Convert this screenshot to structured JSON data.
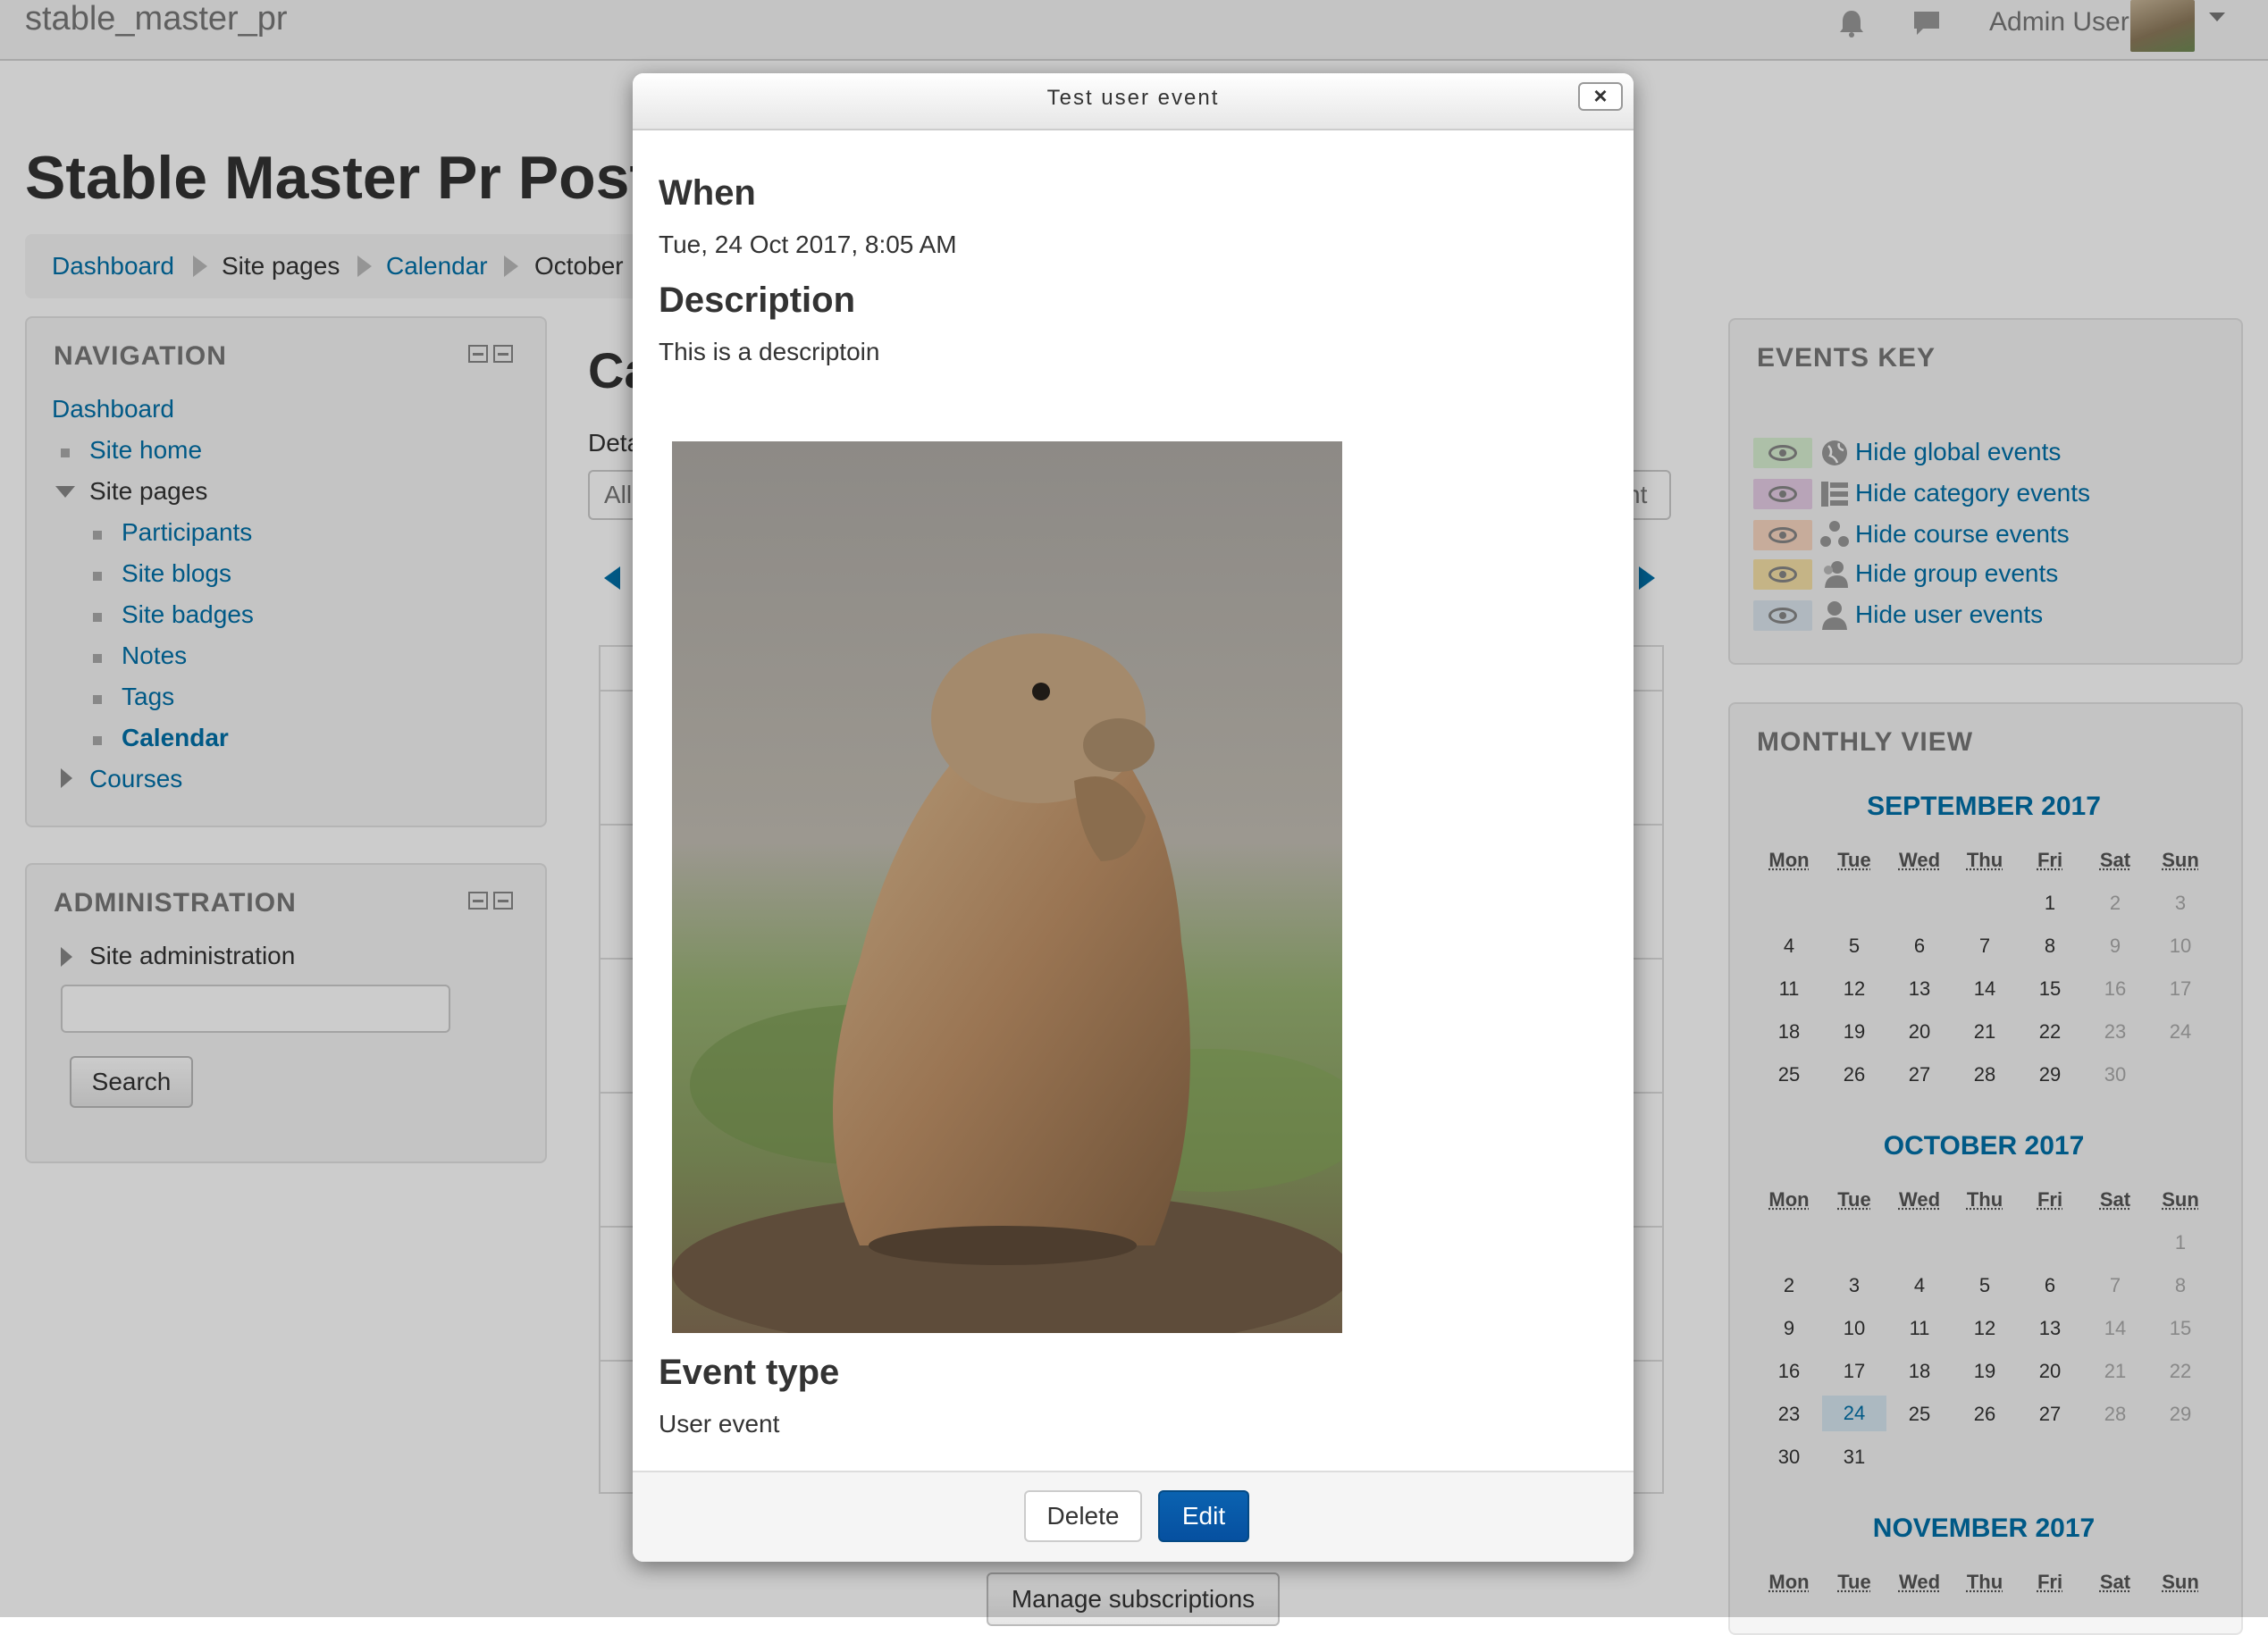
{
  "navbar": {
    "brand": "stable_master_pr",
    "user_name": "Admin User",
    "icons": [
      "notification-bell-icon",
      "messages-icon",
      "user-menu-caret-icon"
    ]
  },
  "page": {
    "title": "Stable Master Pr Postg",
    "breadcrumb": [
      "Dashboard",
      "Site pages",
      "Calendar",
      "October"
    ]
  },
  "navigation": {
    "title": "NAVIGATION",
    "dashboard": "Dashboard",
    "site_home": "Site home",
    "site_pages": "Site pages",
    "items": [
      "Participants",
      "Site blogs",
      "Site badges",
      "Notes",
      "Tags",
      "Calendar"
    ],
    "courses": "Courses"
  },
  "administration": {
    "title": "ADMINISTRATION",
    "site_admin": "Site administration",
    "search_value": "",
    "search_button": "Search"
  },
  "center": {
    "heading_fragment": "Ca",
    "details_fragment": "Deta",
    "filter_fragment_left": "All",
    "filter_fragment_right": "nt",
    "manage_button": "Manage subscriptions"
  },
  "events_key": {
    "title": "EVENTS KEY",
    "items": [
      {
        "label": "Hide global events",
        "color": "#d9f0d3",
        "icon": "globe-icon"
      },
      {
        "label": "Hide category events",
        "color": "#e6cde6",
        "icon": "category-icon"
      },
      {
        "label": "Hide course events",
        "color": "#f9d7c2",
        "icon": "course-icon"
      },
      {
        "label": "Hide group events",
        "color": "#f7e2a8",
        "icon": "group-icon"
      },
      {
        "label": "Hide user events",
        "color": "#dce7ef",
        "icon": "user-icon"
      }
    ]
  },
  "monthly_view": {
    "title": "MONTHLY VIEW",
    "weekdays": [
      "Mon",
      "Tue",
      "Wed",
      "Thu",
      "Fri",
      "Sat",
      "Sun"
    ],
    "months": [
      {
        "name": "SEPTEMBER 2017",
        "first_weekday_index": 4,
        "days": 30,
        "today": null
      },
      {
        "name": "OCTOBER 2017",
        "first_weekday_index": 6,
        "days": 31,
        "today": 24
      },
      {
        "name": "NOVEMBER 2017",
        "first_weekday_index": 2,
        "days": 0,
        "today": null
      }
    ]
  },
  "modal": {
    "title": "Test user event",
    "when_heading": "When",
    "when_value": "Tue, 24 Oct 2017, 8:05 AM",
    "description_heading": "Description",
    "description_value": "This is a descriptoin",
    "event_type_heading": "Event type",
    "event_type_value": "User event",
    "delete_label": "Delete",
    "edit_label": "Edit",
    "close_label": "×"
  },
  "colors": {
    "link": "#0070a8",
    "edit_button": "#0650a0"
  }
}
